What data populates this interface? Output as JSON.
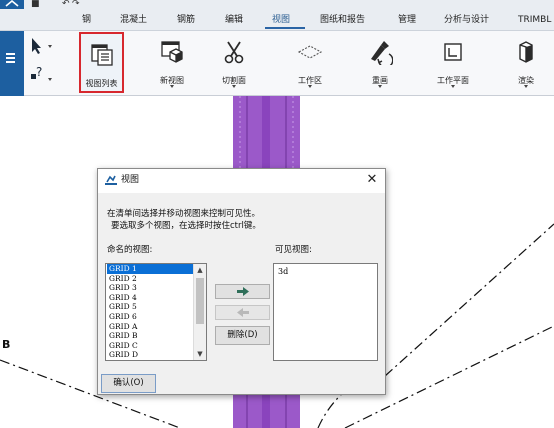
{
  "ribbon_tabs": [
    "钢",
    "混凝土",
    "钢筋",
    "编辑",
    "视图",
    "图纸和报告",
    "管理",
    "分析与设计",
    "TRIMBL"
  ],
  "active_tab": "视图",
  "ribbon_tools": {
    "view_list": "视图列表",
    "new_view": "新视图",
    "cut_plane": "切割面",
    "work_area": "工作区",
    "redraw": "重画",
    "work_plane": "工作平面",
    "render": "渲染"
  },
  "canvas": {
    "grid_label": "B"
  },
  "dialog": {
    "title": "视图",
    "hint_line1": "在清单间选择并移动视图来控制可见性。",
    "hint_line2": "要选取多个视图，在选择时按住ctrl键。",
    "named_views_label": "命名的视图:",
    "visible_views_label": "可见视图:",
    "named_views": [
      "GRID 1",
      "GRID 2",
      "GRID 3",
      "GRID 4",
      "GRID 5",
      "GRID 6",
      "GRID A",
      "GRID B",
      "GRID C",
      "GRID D"
    ],
    "visible_views": [
      "3d"
    ],
    "delete_button": "删除(D)",
    "ok_button": "确认(O)",
    "close_glyph": "✕"
  },
  "colors": {
    "app_blue": "#1d5fa0",
    "highlight_red": "#d7282e",
    "selection_blue": "#0a6fd6",
    "column_purple": "#9b59c9",
    "arrow_green": "#2f6f5a"
  },
  "icons": [
    "view-list-icon",
    "new-view-icon",
    "cut-plane-icon",
    "work-area-icon",
    "redraw-icon",
    "work-plane-icon",
    "render-icon",
    "add-arrow-icon",
    "remove-arrow-icon"
  ]
}
